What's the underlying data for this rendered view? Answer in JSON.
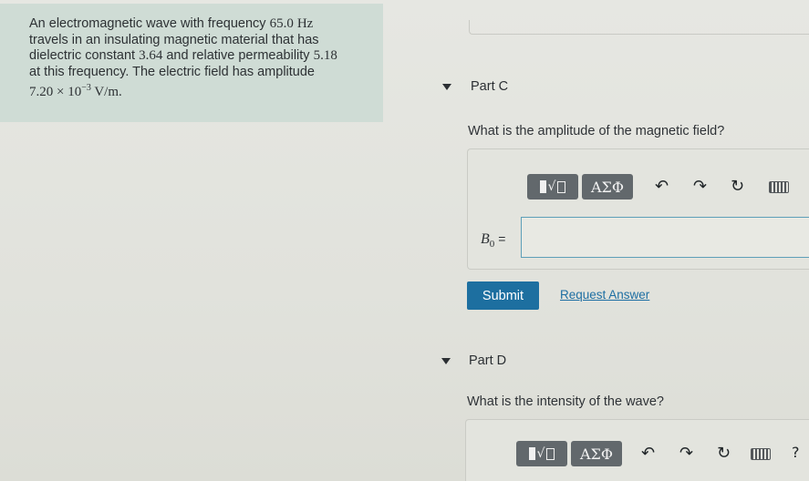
{
  "problem": {
    "line1_prefix": "An electromagnetic wave with frequency ",
    "frequency_value": "65.0",
    "frequency_unit": "Hz",
    "line2": "travels in an insulating magnetic material that has",
    "line3_prefix": "dielectric constant ",
    "dielectric_value": "3.64",
    "line3_mid": " and relative permeability ",
    "permeability_value": "5.18",
    "line4": "at this frequency. The electric field has amplitude",
    "amplitude_mantissa": "7.20 × 10",
    "amplitude_exponent": "−3",
    "amplitude_unit": "V/m."
  },
  "part_c": {
    "title": "Part C",
    "question": "What is the amplitude of the magnetic field?",
    "variable": "B",
    "variable_sub": "0",
    "equals": "=",
    "input_value": "",
    "greek_label": "ΑΣΦ",
    "submit_label": "Submit",
    "request_label": "Request Answer"
  },
  "part_d": {
    "title": "Part D",
    "question": "What is the intensity of the wave?",
    "greek_label": "ΑΣΦ",
    "help_label": "?"
  },
  "icons": {
    "undo": "↶",
    "redo": "↷",
    "reset": "↻"
  },
  "colors": {
    "submit": "#1d6fa0",
    "link": "#1e6fa3",
    "problem_bg": "#cfdcd5",
    "input_border": "#5d9fb8"
  }
}
